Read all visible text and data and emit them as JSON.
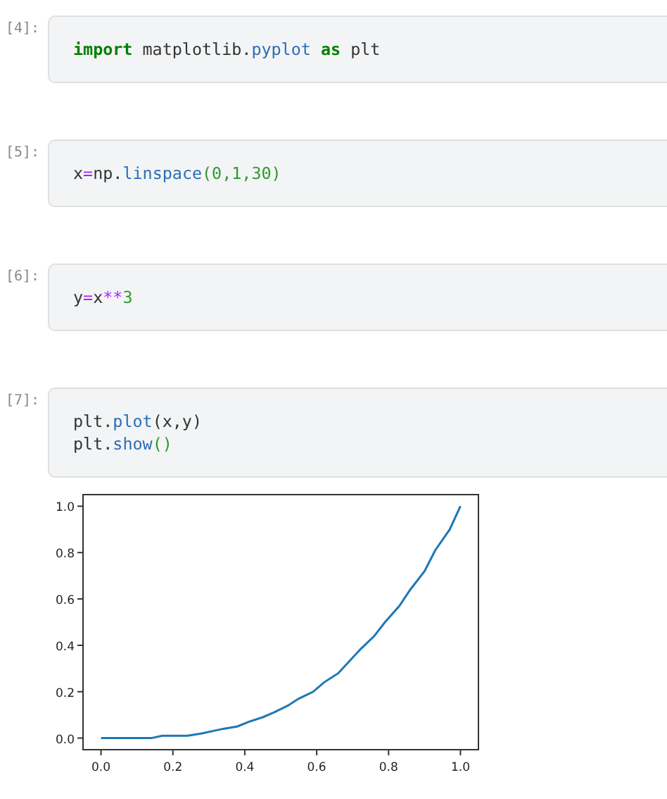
{
  "cells": [
    {
      "prompt": "[4]:",
      "lines": [
        [
          {
            "kind": "keyword",
            "text": "import"
          },
          {
            "kind": "plain",
            "text": " matplotlib."
          },
          {
            "kind": "attr",
            "text": "pyplot"
          },
          {
            "kind": "keyword",
            "text": " as"
          },
          {
            "kind": "plain",
            "text": " plt"
          }
        ]
      ]
    },
    {
      "prompt": "[5]:",
      "lines": [
        [
          {
            "kind": "plain",
            "text": "x"
          },
          {
            "kind": "operator",
            "text": "="
          },
          {
            "kind": "plain",
            "text": "np."
          },
          {
            "kind": "attr",
            "text": "linspace"
          },
          {
            "kind": "number",
            "text": "(0,1,30)"
          }
        ]
      ]
    },
    {
      "prompt": "[6]:",
      "lines": [
        [
          {
            "kind": "plain",
            "text": "y"
          },
          {
            "kind": "operator",
            "text": "="
          },
          {
            "kind": "plain",
            "text": "x"
          },
          {
            "kind": "operator",
            "text": "**"
          },
          {
            "kind": "number",
            "text": "3"
          }
        ]
      ]
    },
    {
      "prompt": "[7]:",
      "lines": [
        [
          {
            "kind": "plain",
            "text": "plt."
          },
          {
            "kind": "attr",
            "text": "plot"
          },
          {
            "kind": "plain",
            "text": "(x,y)"
          }
        ],
        [
          {
            "kind": "plain",
            "text": "plt."
          },
          {
            "kind": "attr",
            "text": "show"
          },
          {
            "kind": "number",
            "text": "()"
          }
        ]
      ],
      "output": {
        "chart_data": {
          "type": "line",
          "x": [
            0,
            0.03,
            0.07,
            0.1,
            0.14,
            0.17,
            0.21,
            0.24,
            0.28,
            0.31,
            0.34,
            0.38,
            0.41,
            0.45,
            0.48,
            0.52,
            0.55,
            0.59,
            0.62,
            0.66,
            0.69,
            0.72,
            0.76,
            0.79,
            0.83,
            0.86,
            0.9,
            0.93,
            0.97,
            1
          ],
          "series": [
            {
              "color": "#1f77b4",
              "values": [
                0,
                0,
                0,
                0,
                0,
                0.01,
                0.01,
                0.01,
                0.02,
                0.03,
                0.04,
                0.05,
                0.07,
                0.09,
                0.11,
                0.14,
                0.17,
                0.2,
                0.24,
                0.28,
                0.33,
                0.38,
                0.44,
                0.5,
                0.57,
                0.64,
                0.72,
                0.81,
                0.9,
                1
              ]
            }
          ],
          "xlim": [
            -0.05,
            1.05
          ],
          "ylim": [
            -0.05,
            1.05
          ],
          "xticks": [
            {
              "value": 0,
              "label": "0.0"
            },
            {
              "value": 0.2,
              "label": "0.2"
            },
            {
              "value": 0.4,
              "label": "0.4"
            },
            {
              "value": 0.6,
              "label": "0.6"
            },
            {
              "value": 0.8,
              "label": "0.8"
            },
            {
              "value": 1,
              "label": "1.0"
            }
          ],
          "yticks": [
            {
              "value": 0,
              "label": "0.0"
            },
            {
              "value": 0.2,
              "label": "0.2"
            },
            {
              "value": 0.4,
              "label": "0.4"
            },
            {
              "value": 0.6,
              "label": "0.6"
            },
            {
              "value": 0.8,
              "label": "0.8"
            },
            {
              "value": 1,
              "label": "1.0"
            }
          ]
        }
      }
    }
  ]
}
